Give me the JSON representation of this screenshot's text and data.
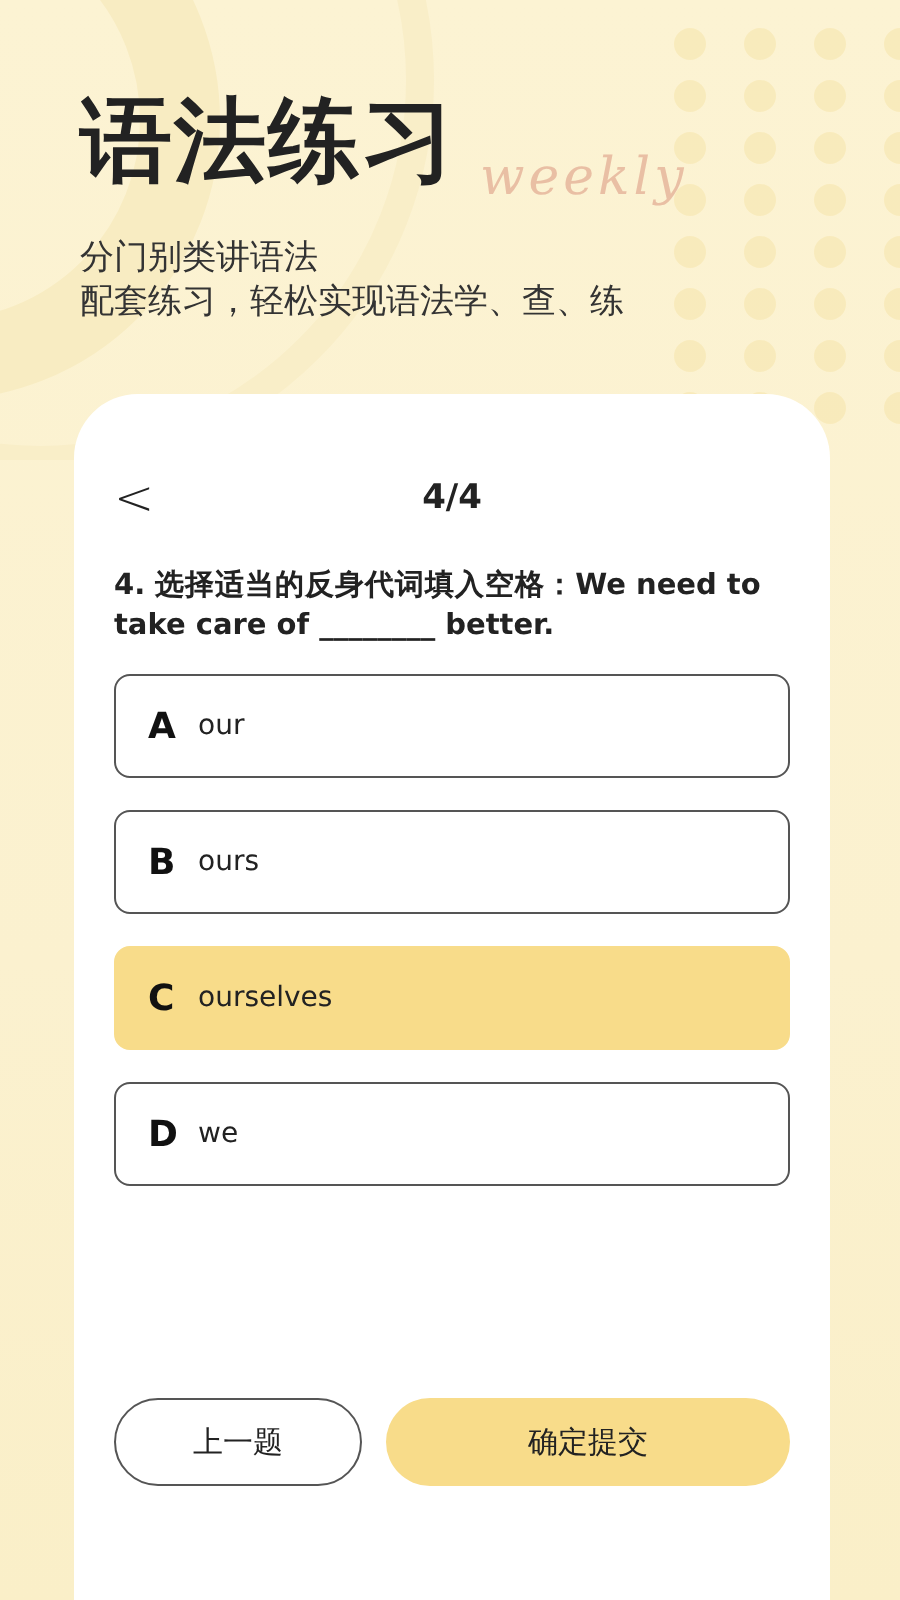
{
  "header": {
    "title": "语法练习",
    "script_text": "weekly",
    "subtitle_lines": [
      "分门别类讲语法",
      "配套练习，轻松实现语法学、查、练"
    ]
  },
  "quiz": {
    "back": "<",
    "progress": "4/4",
    "question": "4. 选择适当的反身代词填入空格：We need to take care of ________ better.",
    "options": [
      {
        "letter": "A",
        "text": "our",
        "selected": false
      },
      {
        "letter": "B",
        "text": "ours",
        "selected": false
      },
      {
        "letter": "C",
        "text": "ourselves",
        "selected": true
      },
      {
        "letter": "D",
        "text": "we",
        "selected": false
      }
    ],
    "buttons": [
      {
        "label": "上一题",
        "kind": "outline"
      },
      {
        "label": "确定提交",
        "kind": "primary"
      }
    ]
  }
}
